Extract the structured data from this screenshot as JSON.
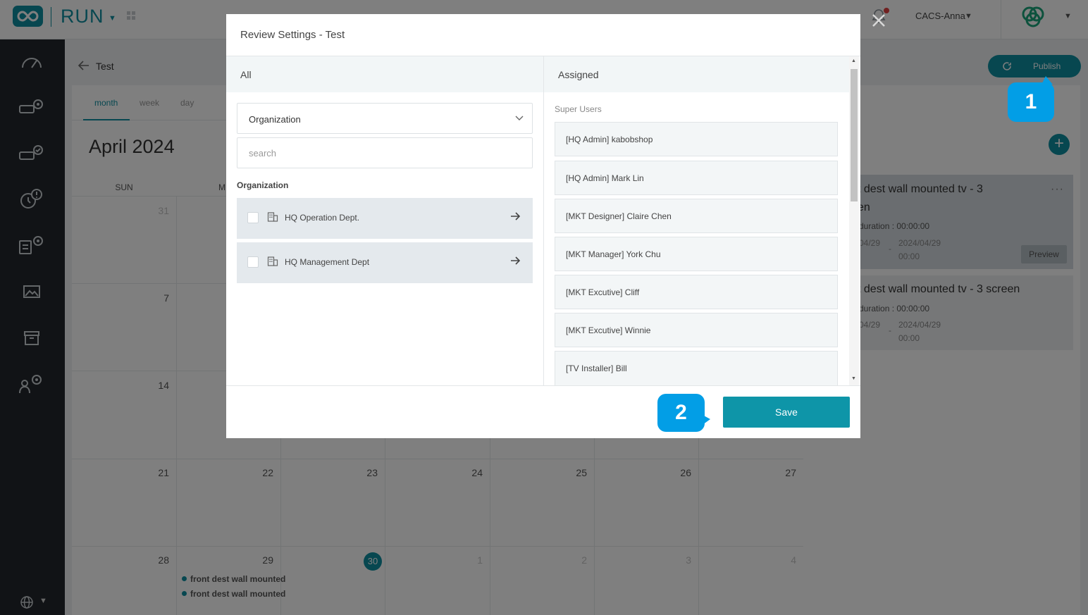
{
  "app": {
    "brand": "RUN",
    "user_name": "CACS-Anna"
  },
  "page": {
    "title": "Test",
    "publish_label": "Publish"
  },
  "calendar": {
    "views": [
      "month",
      "week",
      "day"
    ],
    "active_view": "month",
    "month_title": "April 2024",
    "weekdays": [
      "SUN",
      "M"
    ],
    "rows": [
      {
        "days": [
          "31"
        ],
        "faded": [
          true
        ]
      },
      {
        "days": [
          "7"
        ],
        "faded": [
          false
        ]
      },
      {
        "days": [
          "14"
        ],
        "faded": [
          false
        ]
      },
      {
        "days": [
          "21",
          "22",
          "23",
          "24",
          "25",
          "26",
          "27"
        ],
        "faded": [
          false,
          false,
          false,
          false,
          false,
          false,
          false
        ]
      },
      {
        "days": [
          "28",
          "29",
          "30",
          "1",
          "2",
          "3",
          "4"
        ],
        "faded": [
          false,
          false,
          false,
          true,
          true,
          true,
          true
        ]
      }
    ],
    "today": "30",
    "events": [
      "front dest wall mounted",
      "front dest wall mounted"
    ]
  },
  "side_panel": {
    "cards": [
      {
        "title_line1": "t dest wall mounted tv - 3",
        "title_line2": "en",
        "duration": "duration : 00:00:00",
        "start_date": "04/29",
        "end_date": "2024/04/29",
        "start_time": "",
        "end_time": "00:00",
        "preview_label": "Preview"
      },
      {
        "title_line1": "t dest wall mounted tv - 3 screen",
        "duration": "duration : 00:00:00",
        "start_date": "04/29",
        "end_date": "2024/04/29",
        "end_time": "00:00"
      }
    ],
    "date_separator": "-"
  },
  "modal": {
    "title": "Review Settings - Test",
    "left_header": "All",
    "right_header": "Assigned",
    "select_value": "Organization",
    "search_placeholder": "search",
    "org_section_label": "Organization",
    "organizations": [
      "HQ Operation Dept.",
      "HQ Management Dept"
    ],
    "assigned_group_label": "Super Users",
    "assigned_users": [
      "[HQ Admin] kabobshop",
      "[HQ Admin] Mark Lin",
      "[MKT Designer] Claire Chen",
      "[MKT Manager] York Chu",
      "[MKT Excutive] Cliff",
      "[MKT Excutive] Winnie",
      "[TV Installer] Bill"
    ],
    "save_label": "Save"
  },
  "callouts": [
    "1",
    "2"
  ],
  "colors": {
    "accent": "#0e8fa0",
    "callout": "#029ee6",
    "sidebar": "#23262c"
  },
  "icons": [
    "infinity-logo-icon",
    "apps-grid-icon",
    "bell-icon",
    "chevron-down-icon",
    "org-logo-icon",
    "dashboard-icon",
    "device-settings-icon",
    "device-check-icon",
    "alert-clock-icon",
    "report-settings-icon",
    "image-icon",
    "archive-icon",
    "user-settings-icon",
    "globe-icon",
    "arrow-left-icon",
    "refresh-icon",
    "building-icon",
    "arrow-right-icon",
    "more-icon",
    "plus-icon"
  ]
}
